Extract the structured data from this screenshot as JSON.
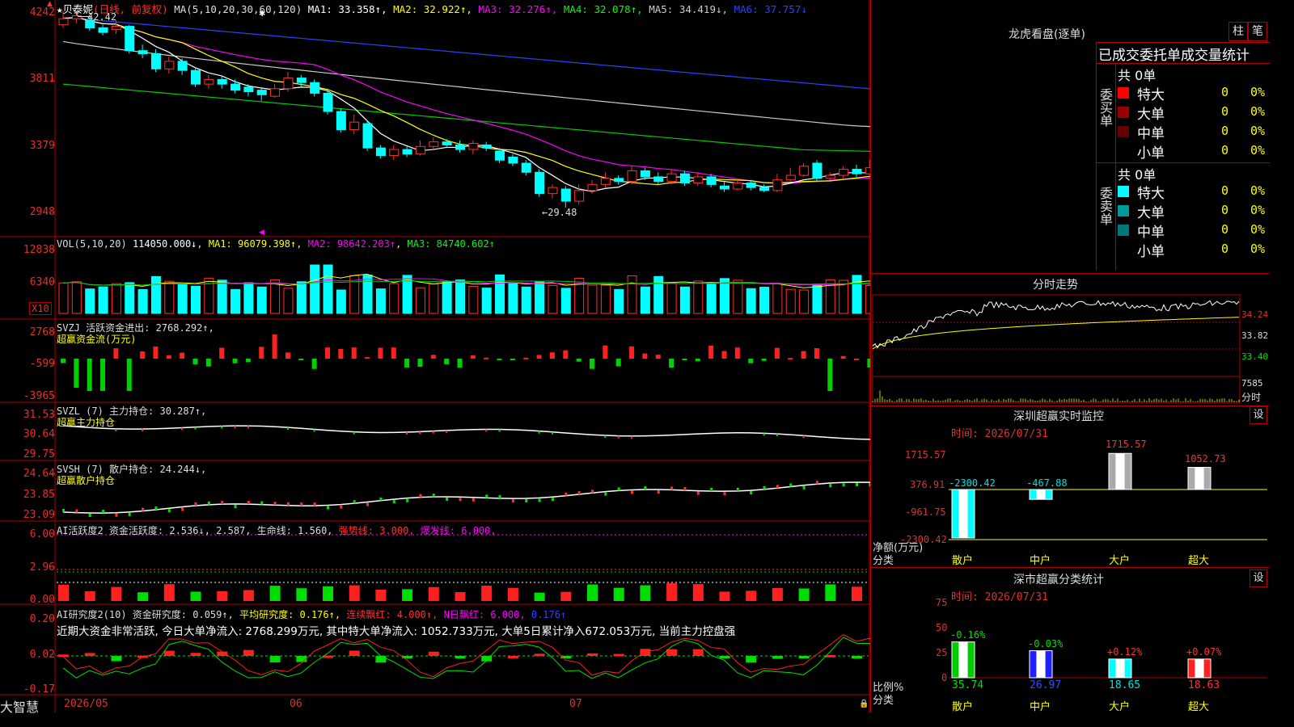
{
  "main": {
    "title_star": "★",
    "stock_name": "贝泰妮",
    "period": "(日线, 前复权)",
    "ma_label": "MA(5,10,20,30,60,120)",
    "ma": [
      {
        "text": "MA1: 33.358↑",
        "color": "#ffffff"
      },
      {
        "text": "MA2: 32.922↑",
        "color": "#ffff00"
      },
      {
        "text": "MA3: 32.276↑",
        "color": "#ff00ff"
      },
      {
        "text": "MA4: 32.078↑",
        "color": "#00ff00"
      },
      {
        "text": "MA5: 34.419↓",
        "color": "#cccccc"
      },
      {
        "text": "MA6: 37.757↓",
        "color": "#3040ff"
      }
    ],
    "high_label": "42.42",
    "low_label": "←29.48",
    "axis": [
      "4242",
      "3811",
      "3379",
      "2948"
    ]
  },
  "vol": {
    "title": "VOL(5,10,20)",
    "value": "114050.000↓",
    "ma1": "MA1: 96079.398↑",
    "ma2": "MA2: 98642.203↑",
    "ma3": "MA3: 84740.602↑",
    "axis": [
      "12838",
      "6340"
    ],
    "unit": "X10"
  },
  "svzj": {
    "title": "SVZJ  活跃资金进出: 2768.292↑,",
    "sub": "超赢资金流(万元)",
    "axis": [
      "2768",
      "-599",
      "-3965"
    ]
  },
  "svzl": {
    "title": "SVZL (7) 主力持仓: 30.287↑,",
    "sub": "超赢主力持仓",
    "axis": [
      "31.53",
      "30.64",
      "29.75"
    ]
  },
  "svsh": {
    "title": "SVSH (7) 散户持仓: 24.244↓,",
    "sub": "超赢散户持仓",
    "axis": [
      "24.64",
      "23.85",
      "23.09"
    ]
  },
  "ai1": {
    "title": "AI活跃度2 资金活跃度: 2.536↓, 2.587, 生命线: 1.560,",
    "strong": "强势线: 3.000,",
    "burst": "爆发线: 6.000,",
    "axis": [
      "6.00",
      "2.96",
      "0.00"
    ]
  },
  "ai2": {
    "title": "AI研究度2(10) 资金研究度: 0.059↑,",
    "avg": "平均研究度: 0.176↑,",
    "red": "连续飘红: 4.000↑,",
    "nred": "N日飘红: 6.000,",
    "val": "0.176↑",
    "note": "近期大资金非常活跃, 今日大单净流入: 2768.299万元, 其中特大单净流入: 1052.733万元, 大单5日累计净入672.053万元, 当前主力控盘强",
    "axis": [
      "0.20",
      "0.02",
      "-0.17"
    ]
  },
  "xaxis": [
    "2026/05",
    "06",
    "07"
  ],
  "logo": "大智慧",
  "right": {
    "lhb_title": "龙虎看盘(逐单)",
    "btn_zhu": "柱",
    "btn_bi": "笔",
    "stats_title": "已成交委托单成交量统计",
    "buy_label": "委买单",
    "sell_label": "委卖单",
    "buy_total": "共 0单",
    "sell_total": "共 0单",
    "buy_rows": [
      {
        "name": "特大",
        "count": "0",
        "pct": "0%",
        "color": "#ff0000"
      },
      {
        "name": "大单",
        "count": "0",
        "pct": "0%",
        "color": "#990000"
      },
      {
        "name": "中单",
        "count": "0",
        "pct": "0%",
        "color": "#660000"
      },
      {
        "name": "小单",
        "count": "0",
        "pct": "0%",
        "color": ""
      }
    ],
    "sell_rows": [
      {
        "name": "特大",
        "count": "0",
        "pct": "0%",
        "color": "#00ffff"
      },
      {
        "name": "大单",
        "count": "0",
        "pct": "0%",
        "color": "#009999"
      },
      {
        "name": "中单",
        "count": "0",
        "pct": "0%",
        "color": "#007777"
      },
      {
        "name": "小单",
        "count": "0",
        "pct": "0%",
        "color": ""
      }
    ],
    "intraday_title": "分时走势",
    "intraday_axis": [
      "34.24",
      "33.82",
      "33.40",
      "7585",
      "分时"
    ],
    "monitor_title": "深圳超赢实时监控",
    "monitor_btn": "设",
    "monitor_time": "时间: 2026/07/31",
    "monitor_axis": [
      "1715.57",
      "376.91",
      "-961.75",
      "-2300.42"
    ],
    "monitor_ylabel": "净额(万元)",
    "monitor_xlabel": "分类",
    "monitor_cats": [
      "散户",
      "中户",
      "大户",
      "超大"
    ],
    "monitor_vals": [
      "-2300.42",
      "-467.88",
      "1715.57",
      "1052.73"
    ],
    "class_title": "深市超赢分类统计",
    "class_btn": "设",
    "class_time": "时间: 2026/07/31",
    "class_axis": [
      "75",
      "50",
      "25",
      "0"
    ],
    "class_ylabel": "比例%",
    "class_xlabel": "分类",
    "class_cats": [
      "散户",
      "中户",
      "大户",
      "超大"
    ],
    "class_pct": [
      "-0.16%",
      "-0.03%",
      "+0.12%",
      "+0.07%"
    ],
    "class_vals": [
      "35.74",
      "26.97",
      "18.65",
      "18.63"
    ]
  },
  "chart_data": {
    "type": "candlestick",
    "candles": [
      [
        41.5,
        41.9,
        42.42,
        41.3
      ],
      [
        41.9,
        42.1,
        42.3,
        41.6
      ],
      [
        41.8,
        41.3,
        42.0,
        41.1
      ],
      [
        41.3,
        41.0,
        41.5,
        40.8
      ],
      [
        41.2,
        41.4,
        41.8,
        40.9
      ],
      [
        41.4,
        39.8,
        41.5,
        39.6
      ],
      [
        39.8,
        39.6,
        40.2,
        39.3
      ],
      [
        39.6,
        38.6,
        39.9,
        38.4
      ],
      [
        38.6,
        39.1,
        39.4,
        38.3
      ],
      [
        39.1,
        38.5,
        39.3,
        38.2
      ],
      [
        38.5,
        37.6,
        38.7,
        37.4
      ],
      [
        37.6,
        37.9,
        38.2,
        37.3
      ],
      [
        37.9,
        37.6,
        38.1,
        37.3
      ],
      [
        37.6,
        37.2,
        37.9,
        37.0
      ],
      [
        37.4,
        37.1,
        37.6,
        36.8
      ],
      [
        37.2,
        36.9,
        37.4,
        36.5
      ],
      [
        36.8,
        37.3,
        37.6,
        36.7
      ],
      [
        37.3,
        38.0,
        38.4,
        37.1
      ],
      [
        38.0,
        37.7,
        38.2,
        37.4
      ],
      [
        37.7,
        37.0,
        37.9,
        36.8
      ],
      [
        37.0,
        35.8,
        37.2,
        35.6
      ],
      [
        35.8,
        34.6,
        36.0,
        34.4
      ],
      [
        34.6,
        35.1,
        35.6,
        34.3
      ],
      [
        35.0,
        33.4,
        35.2,
        33.2
      ],
      [
        33.4,
        32.9,
        33.6,
        32.7
      ],
      [
        32.9,
        33.3,
        33.6,
        32.6
      ],
      [
        33.3,
        33.0,
        33.5,
        32.8
      ],
      [
        33.0,
        33.5,
        33.9,
        32.9
      ],
      [
        33.5,
        33.8,
        34.1,
        33.3
      ],
      [
        33.8,
        33.6,
        34.0,
        33.4
      ],
      [
        33.6,
        33.3,
        33.9,
        33.1
      ],
      [
        33.3,
        33.7,
        33.9,
        33.0
      ],
      [
        33.6,
        33.4,
        33.8,
        33.2
      ],
      [
        33.2,
        32.6,
        33.4,
        32.4
      ],
      [
        32.8,
        32.4,
        33.0,
        32.2
      ],
      [
        32.4,
        31.8,
        32.6,
        31.6
      ],
      [
        31.8,
        30.4,
        32.0,
        30.2
      ],
      [
        30.4,
        30.8,
        31.0,
        30.1
      ],
      [
        30.7,
        29.9,
        30.9,
        29.48
      ],
      [
        29.9,
        30.6,
        31.0,
        29.7
      ],
      [
        30.6,
        31.0,
        31.3,
        30.4
      ],
      [
        31.0,
        31.4,
        31.8,
        30.8
      ],
      [
        31.4,
        31.2,
        31.6,
        31.0
      ],
      [
        31.2,
        31.9,
        32.2,
        31.0
      ],
      [
        31.9,
        31.5,
        32.1,
        31.3
      ],
      [
        31.5,
        31.2,
        31.8,
        31.0
      ],
      [
        31.2,
        31.7,
        32.0,
        31.0
      ],
      [
        31.7,
        31.1,
        31.9,
        30.9
      ],
      [
        31.1,
        31.5,
        31.8,
        30.9
      ],
      [
        31.5,
        31.0,
        31.7,
        30.8
      ],
      [
        30.9,
        30.7,
        31.2,
        30.5
      ],
      [
        30.7,
        31.1,
        31.4,
        30.6
      ],
      [
        31.1,
        30.8,
        31.3,
        30.6
      ],
      [
        30.8,
        30.6,
        31.0,
        30.5
      ],
      [
        30.6,
        31.3,
        31.7,
        30.5
      ],
      [
        31.3,
        31.6,
        32.1,
        31.2
      ],
      [
        31.6,
        32.2,
        32.4,
        31.5
      ],
      [
        32.4,
        31.4,
        32.6,
        31.2
      ],
      [
        31.4,
        31.6,
        31.8,
        31.3
      ],
      [
        31.6,
        32.0,
        32.2,
        31.4
      ],
      [
        32.0,
        31.7,
        32.3,
        31.5
      ],
      [
        31.7,
        32.1,
        32.6,
        31.6
      ],
      [
        32.1,
        32.4,
        32.8,
        32.0
      ],
      [
        32.3,
        31.6,
        32.5,
        31.4
      ],
      [
        31.5,
        30.9,
        31.7,
        30.7
      ],
      [
        31.0,
        31.8,
        32.0,
        30.9
      ],
      [
        31.8,
        32.2,
        32.5,
        31.7
      ],
      [
        32.2,
        32.0,
        32.5,
        31.8
      ],
      [
        32.0,
        32.7,
        33.0,
        31.9
      ],
      [
        32.6,
        33.5,
        33.8,
        32.4
      ],
      [
        33.4,
        33.6,
        33.9,
        33.2
      ]
    ],
    "y_range": [
      29.0,
      42.6
    ]
  }
}
